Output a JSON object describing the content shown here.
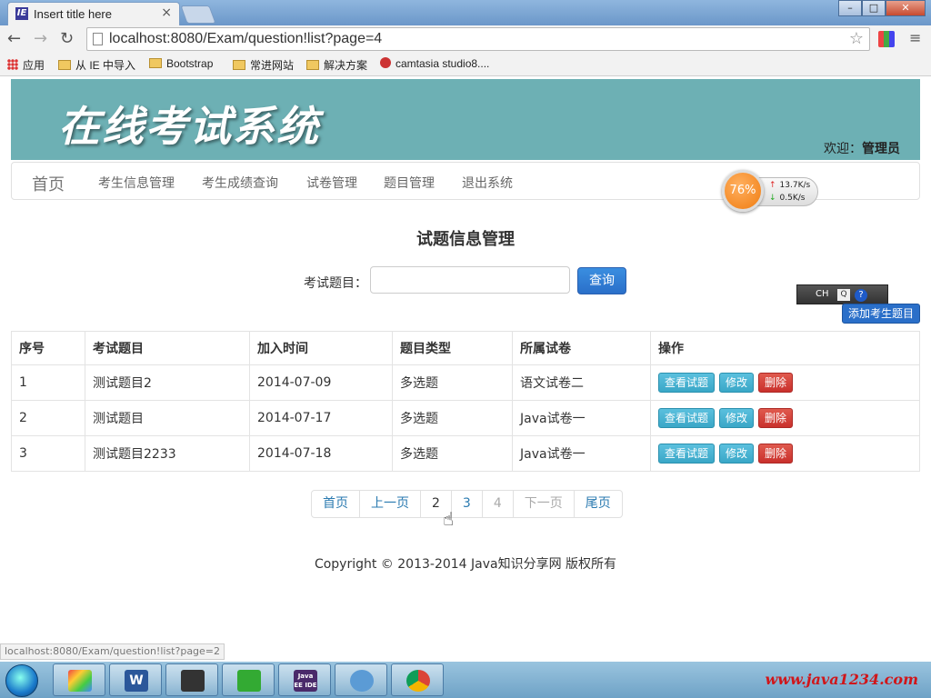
{
  "browser": {
    "tab_title": "Insert title here",
    "tab_favicon": "IE",
    "tab_close": "×",
    "url": "localhost:8080/Exam/question!list?page=4",
    "back_icon": "←",
    "forward_icon": "→",
    "reload_icon": "↻",
    "star_icon": "☆",
    "menu_icon": "≡",
    "bookmarks": [
      "应用",
      "从 IE 中导入",
      "Bootstrap",
      "常进网站",
      "解决方案",
      "camtasia studio8...."
    ],
    "status_url": "localhost:8080/Exam/question!list?page=2",
    "win_minimize": "–",
    "win_maximize": "□",
    "win_close": "✕"
  },
  "header": {
    "title": "在线考试系统",
    "welcome_label": "欢迎：",
    "welcome_user": "管理员"
  },
  "nav": {
    "brand": "首页",
    "items": [
      "考生信息管理",
      "考生成绩查询",
      "试卷管理",
      "题目管理",
      "退出系统"
    ]
  },
  "speed_widget": {
    "percent": "76%",
    "upload": "13.7K/s",
    "download": "0.5K/s"
  },
  "ime": {
    "text": "CH",
    "box": "Q",
    "help": "?"
  },
  "main": {
    "heading": "试题信息管理",
    "search_label": "考试题目：",
    "search_value": "",
    "search_button": "查询",
    "add_button": "添加考生题目"
  },
  "table": {
    "columns": [
      "序号",
      "考试题目",
      "加入时间",
      "题目类型",
      "所属试卷",
      "操作"
    ],
    "rows": [
      {
        "no": "1",
        "title": "测试题目2",
        "date": "2014-07-09",
        "type": "多选题",
        "paper": "语文试卷二"
      },
      {
        "no": "2",
        "title": "测试题目",
        "date": "2014-07-17",
        "type": "多选题",
        "paper": "Java试卷一"
      },
      {
        "no": "3",
        "title": "测试题目2233",
        "date": "2014-07-18",
        "type": "多选题",
        "paper": "Java试卷一"
      }
    ],
    "actions": {
      "view": "查看试题",
      "edit": "修改",
      "delete": "删除"
    }
  },
  "pagination": {
    "first": "首页",
    "prev": "上一页",
    "pages": [
      "2",
      "3",
      "4"
    ],
    "next": "下一页",
    "last": "尾页",
    "current_page": 4
  },
  "footer": {
    "copyright": "Copyright © 2013-2014 Java知识分享网 版权所有"
  },
  "taskbar": {
    "app_word": "W",
    "app_javaee": "Java EE IDE",
    "watermark": "www.java1234.com"
  },
  "colors": {
    "banner": "#6db0b4",
    "primary": "#2a6fc9",
    "info": "#5bc0de",
    "danger": "#c9302c"
  }
}
